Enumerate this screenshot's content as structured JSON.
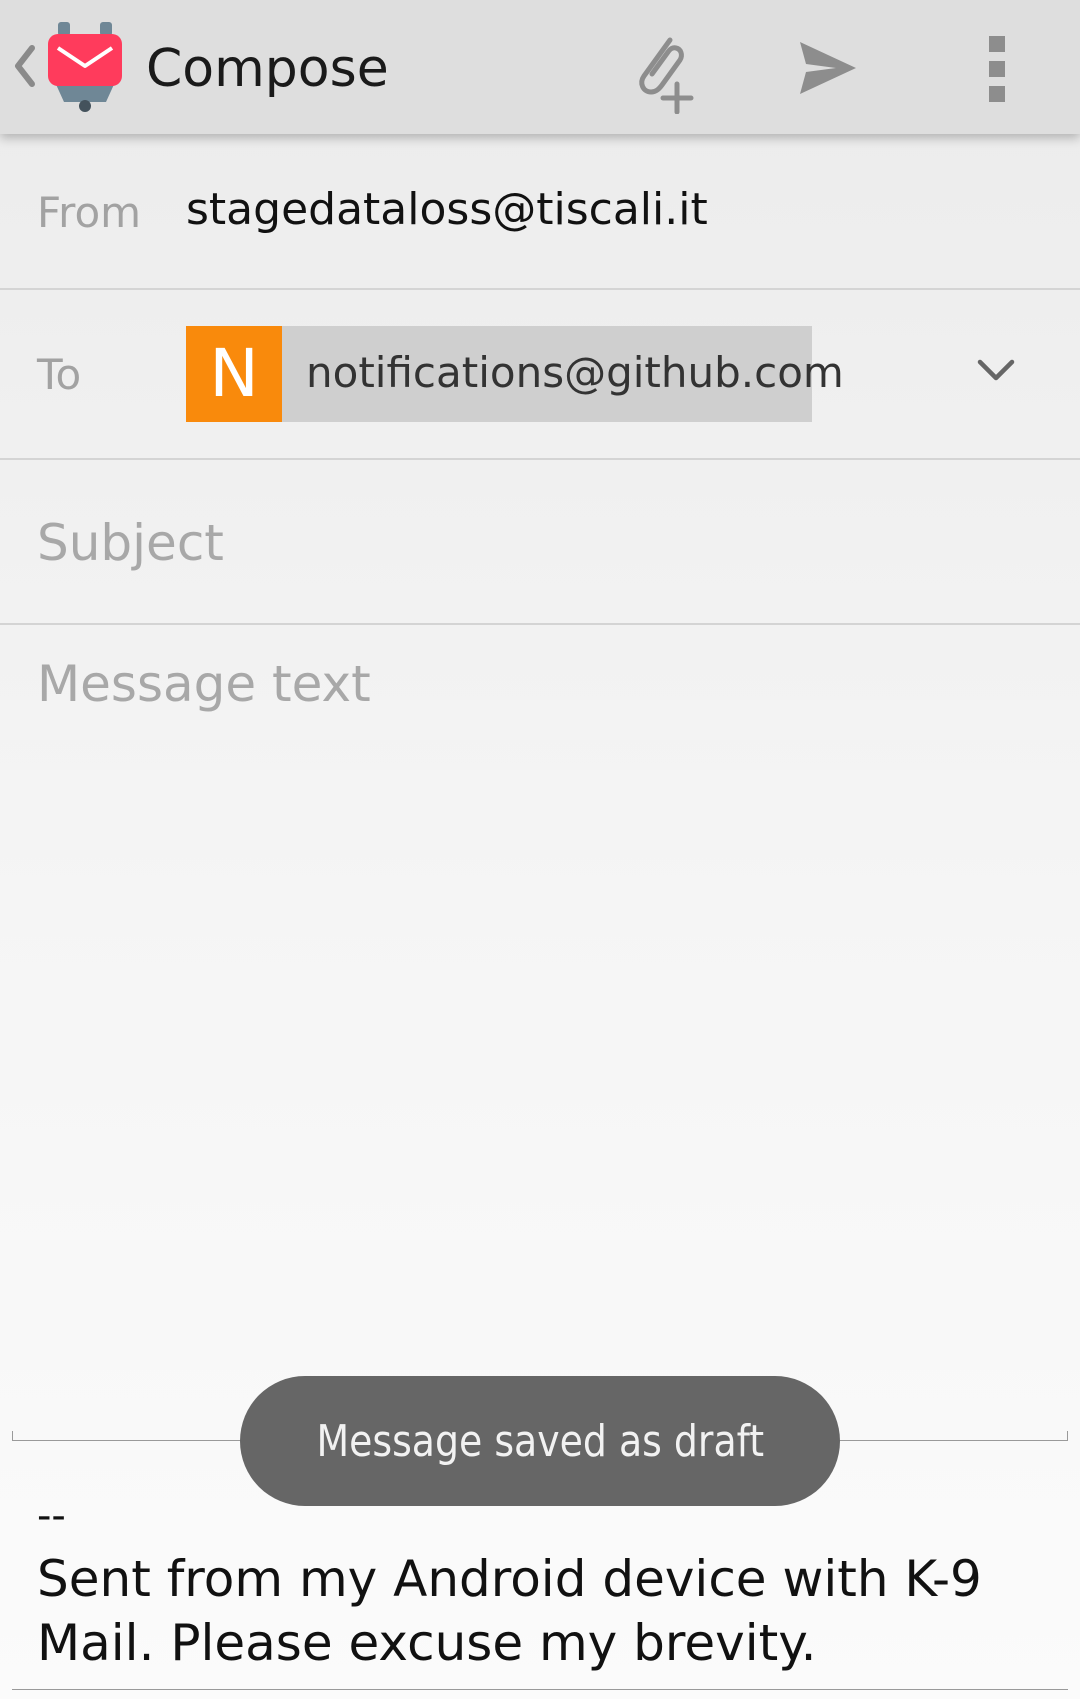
{
  "appbar": {
    "title": "Compose",
    "icons": {
      "back": "chevron-left-icon",
      "logo": "k9-mail-logo-icon",
      "attach": "attach-file-icon",
      "send": "send-icon",
      "overflow": "more-vert-icon"
    }
  },
  "from": {
    "label": "From",
    "value": "stagedataloss@tiscali.it"
  },
  "to": {
    "label": "To",
    "recipient": {
      "initial": "N",
      "email": "notifications@github.com",
      "avatar_color": "#F98A0C"
    }
  },
  "subject": {
    "placeholder": "Subject",
    "value": ""
  },
  "message": {
    "placeholder": "Message text",
    "value": ""
  },
  "signature": {
    "separator": "--",
    "text": "Sent from my Android device with K-9 Mail. Please excuse my brevity."
  },
  "toast": {
    "text": "Message saved as draft"
  },
  "colors": {
    "appbar": "#DEDEDE",
    "accent_logo": "#FF3B5C",
    "toast_bg": "#666666"
  }
}
